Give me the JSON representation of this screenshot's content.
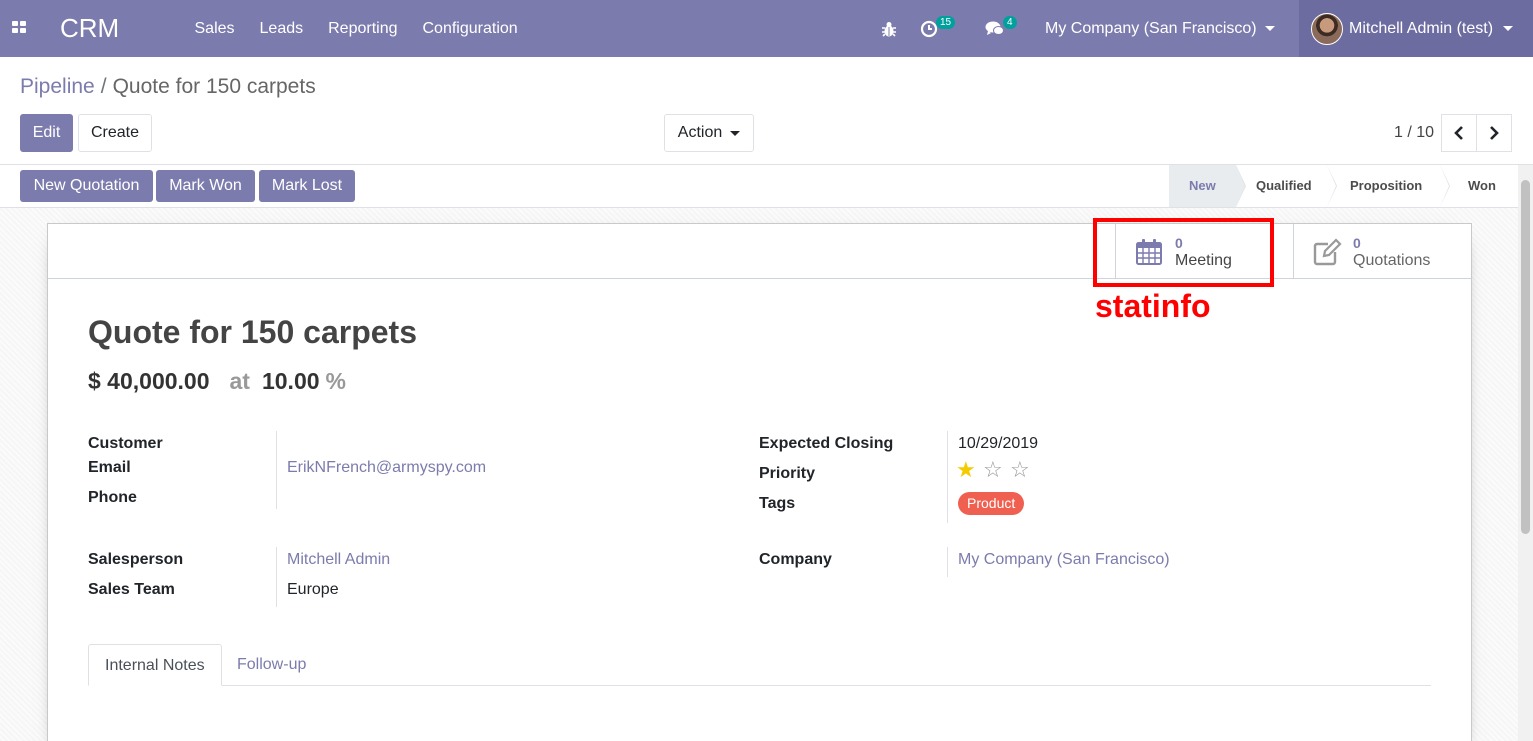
{
  "navbar": {
    "app_name": "CRM",
    "menu": [
      "Sales",
      "Leads",
      "Reporting",
      "Configuration"
    ],
    "activity_count": "15",
    "message_count": "4",
    "company": "My Company (San Francisco)",
    "user": "Mitchell Admin (test)",
    "color": "#7c7bad"
  },
  "breadcrumb": {
    "parent": "Pipeline",
    "separator": "/",
    "current": "Quote for 150 carpets"
  },
  "control_panel": {
    "edit_label": "Edit",
    "create_label": "Create",
    "action_label": "Action",
    "pager": "1 / 10"
  },
  "header_buttons": {
    "new_quotation": "New Quotation",
    "mark_won": "Mark Won",
    "mark_lost": "Mark Lost"
  },
  "stages": {
    "items": [
      "New",
      "Qualified",
      "Proposition",
      "Won"
    ],
    "active": "New"
  },
  "stat_buttons": {
    "meeting": {
      "value": "0",
      "label": "Meeting",
      "icon": "calendar-icon"
    },
    "quotations": {
      "value": "0",
      "label": "Quotations",
      "icon": "pencil-square-icon"
    }
  },
  "annotation": {
    "text": "statinfo",
    "color": "#ff0000"
  },
  "lead": {
    "title": "Quote for 150 carpets",
    "expected_revenue": "$ 40,000.00",
    "at_label": "at",
    "probability": "10.00",
    "percent_sign": "%"
  },
  "fields": {
    "customer_label": "Customer",
    "email_label": "Email",
    "email_value": "ErikNFrench@armyspy.com",
    "phone_label": "Phone",
    "salesperson_label": "Salesperson",
    "salesperson_value": "Mitchell Admin",
    "sales_team_label": "Sales Team",
    "sales_team_value": "Europe",
    "expected_closing_label": "Expected Closing",
    "expected_closing_value": "10/29/2019",
    "priority_label": "Priority",
    "priority_stars": 1,
    "priority_max": 3,
    "tags_label": "Tags",
    "tag_value": "Product",
    "tag_color": "#f06050",
    "company_label": "Company",
    "company_value": "My Company (San Francisco)"
  },
  "tabs": {
    "internal_notes": "Internal Notes",
    "follow_up": "Follow-up"
  }
}
